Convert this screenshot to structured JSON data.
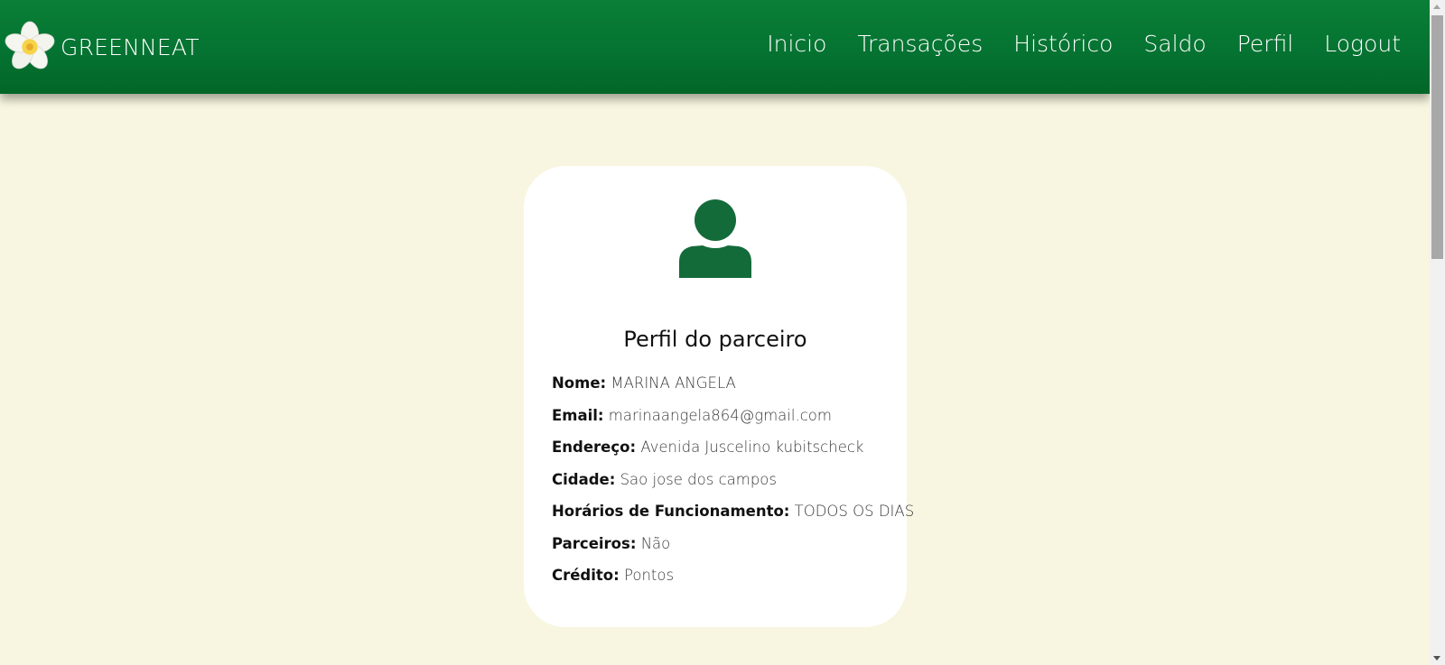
{
  "brand": {
    "name": "GREENNEAT",
    "logo_icon": "plumeria-flower-icon"
  },
  "nav": {
    "items": [
      {
        "label": "Inicio"
      },
      {
        "label": "Transações"
      },
      {
        "label": "Histórico"
      },
      {
        "label": "Saldo"
      },
      {
        "label": "Perfil"
      },
      {
        "label": "Logout"
      }
    ]
  },
  "profile": {
    "avatar_icon": "user-icon",
    "title": "Perfil do parceiro",
    "fields": [
      {
        "label": "Nome:",
        "value": "MARINA ANGELA"
      },
      {
        "label": "Email:",
        "value": "marinaangela864@gmail.com"
      },
      {
        "label": "Endereço:",
        "value": "Avenida Juscelino kubitscheck"
      },
      {
        "label": "Cidade:",
        "value": "Sao jose dos campos"
      },
      {
        "label": "Horários de Funcionamento:",
        "value": "TODOS OS DIAS"
      },
      {
        "label": "Parceiros:",
        "value": "Não"
      },
      {
        "label": "Crédito:",
        "value": "Pontos"
      }
    ]
  },
  "colors": {
    "navbar": "#057332",
    "background": "#f8f6e0",
    "avatar": "#146b3a",
    "card": "#ffffff"
  }
}
